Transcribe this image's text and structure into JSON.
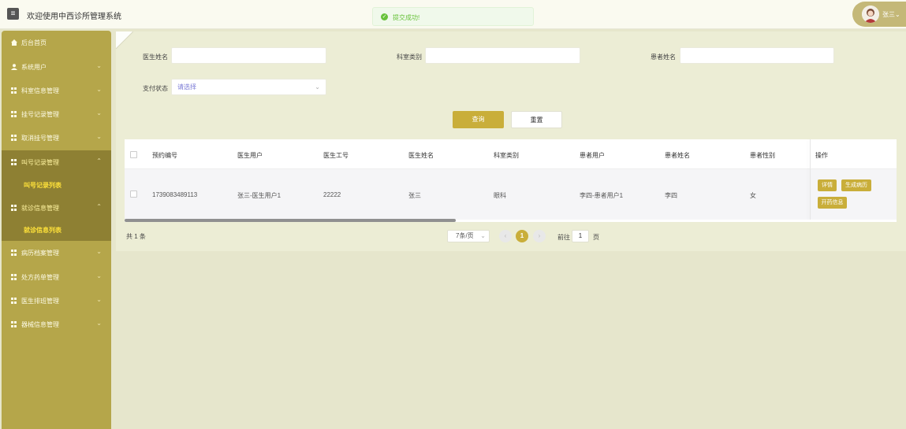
{
  "header": {
    "menu_icon": "hamburger-icon",
    "title": "欢迎使用中西诊所管理系统",
    "user_name": "张三",
    "user_menu_icon": "chevron-down-icon"
  },
  "toast": {
    "icon": "check-circle-icon",
    "text": "提交成功!",
    "color": "#67c23a"
  },
  "sidebar": {
    "bg_color": "#b5a64a",
    "items": [
      {
        "label": "后台首页",
        "icon": "home-icon"
      },
      {
        "label": "系统用户",
        "icon": "user-icon"
      },
      {
        "label": "科室信息管理",
        "icon": "grid-icon"
      },
      {
        "label": "挂号记录管理",
        "icon": "grid-icon"
      },
      {
        "label": "取消挂号管理",
        "icon": "grid-icon"
      },
      {
        "label": "叫号记录管理",
        "icon": "grid-icon",
        "sub": "叫号记录列表"
      },
      {
        "label": "就诊信息管理",
        "icon": "grid-icon",
        "sub": "就诊信息列表"
      },
      {
        "label": "病历档案管理",
        "icon": "grid-icon"
      },
      {
        "label": "处方药单管理",
        "icon": "grid-icon"
      },
      {
        "label": "医生排班管理",
        "icon": "grid-icon"
      },
      {
        "label": "器械信息管理",
        "icon": "grid-icon"
      }
    ]
  },
  "filters": {
    "doctor_name_label": "医生姓名",
    "doctor_name_value": "",
    "dept_type_label": "科室类别",
    "dept_type_value": "",
    "patient_name_label": "患者姓名",
    "patient_name_value": "",
    "pay_status_label": "支付状态",
    "pay_status_placeholder": "请选择"
  },
  "buttons": {
    "query": "查询",
    "reset": "重置"
  },
  "table": {
    "headers": [
      "预约编号",
      "医生用户",
      "医生工号",
      "医生姓名",
      "科室类别",
      "患者用户",
      "患者姓名",
      "患者性别",
      "操作"
    ],
    "rows": [
      {
        "cells": [
          "1739083489113",
          "张三-医生用户1",
          "22222",
          "张三",
          "眼科",
          "李四-患者用户1",
          "李四",
          "女"
        ],
        "actions": [
          "详情",
          "生成病历",
          "开药信息"
        ]
      }
    ]
  },
  "pagination": {
    "total": "共 1 条",
    "page_size": "7条/页",
    "current_page": "1",
    "goto_prefix": "前往",
    "goto_value": "1",
    "goto_suffix": "页"
  },
  "colors": {
    "accent": "#c9ae3a",
    "sidebar_active": "#8e8033",
    "sub_item_text": "#ffe23a",
    "page_bg": "#e6e6cc"
  }
}
